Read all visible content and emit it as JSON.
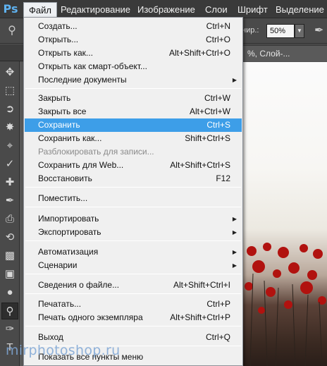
{
  "app": {
    "logo": "Ps"
  },
  "menubar": {
    "items": [
      {
        "label": "Файл",
        "active": true
      },
      {
        "label": "Редактирование"
      },
      {
        "label": "Изображение"
      },
      {
        "label": "Слои"
      },
      {
        "label": "Шрифт"
      },
      {
        "label": "Выделение"
      }
    ]
  },
  "options_bar": {
    "zoom_label": "нир.:",
    "zoom_value": "50%"
  },
  "document": {
    "tab_title": "%, Слой-..."
  },
  "tools": [
    "move-icon",
    "marquee-icon",
    "lasso-icon",
    "quick-select-icon",
    "crop-icon",
    "eyedropper-icon",
    "healing-brush-icon",
    "brush-icon",
    "clone-stamp-icon",
    "history-brush-icon",
    "eraser-icon",
    "gradient-icon",
    "blur-icon",
    "dodge-icon",
    "pen-icon",
    "type-icon"
  ],
  "file_menu": {
    "items": [
      {
        "label": "Создать...",
        "shortcut": "Ctrl+N"
      },
      {
        "label": "Открыть...",
        "shortcut": "Ctrl+O"
      },
      {
        "label": "Открыть как...",
        "shortcut": "Alt+Shift+Ctrl+O"
      },
      {
        "label": "Открыть как смарт-объект..."
      },
      {
        "label": "Последние документы",
        "submenu": true
      },
      {
        "label": "Закрыть",
        "shortcut": "Ctrl+W"
      },
      {
        "label": "Закрыть все",
        "shortcut": "Alt+Ctrl+W"
      },
      {
        "label": "Сохранить",
        "shortcut": "Ctrl+S",
        "highlighted": true
      },
      {
        "label": "Сохранить как...",
        "shortcut": "Shift+Ctrl+S"
      },
      {
        "label": "Разблокировать для записи...",
        "disabled": true
      },
      {
        "label": "Сохранить для Web...",
        "shortcut": "Alt+Shift+Ctrl+S"
      },
      {
        "label": "Восстановить",
        "shortcut": "F12"
      },
      {
        "label": "Поместить..."
      },
      {
        "label": "Импортировать",
        "submenu": true
      },
      {
        "label": "Экспортировать",
        "submenu": true
      },
      {
        "label": "Автоматизация",
        "submenu": true
      },
      {
        "label": "Сценарии",
        "submenu": true
      },
      {
        "label": "Сведения о файле...",
        "shortcut": "Alt+Shift+Ctrl+I"
      },
      {
        "label": "Печатать...",
        "shortcut": "Ctrl+P"
      },
      {
        "label": "Печать одного экземпляра",
        "shortcut": "Alt+Shift+Ctrl+P"
      },
      {
        "label": "Выход",
        "shortcut": "Ctrl+Q"
      },
      {
        "label": "Показать все пункты меню"
      }
    ],
    "submenu_arrow": "▶"
  },
  "watermark": "mirphotoshop.ru"
}
